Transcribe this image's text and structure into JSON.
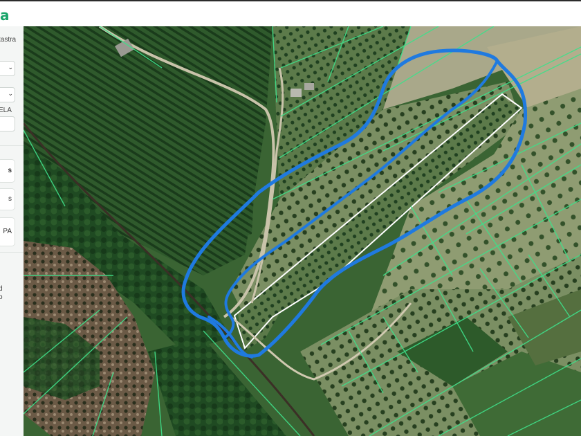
{
  "app": {
    "logo_text": "a"
  },
  "sidebar": {
    "cadastre_label": "tastra",
    "parcel_label": "ELA",
    "cards": [
      {
        "label": "s"
      },
      {
        "label": "s"
      },
      {
        "label": "PA"
      }
    ],
    "footnote_line1": "d",
    "footnote_line2": "o"
  },
  "map": {
    "layer": "satellite",
    "colors": {
      "parcel_lines": "#3fe08a",
      "drawn_outline": "#1f7ae0",
      "selected_parcel": "#ffffff",
      "tree_rows": "#0f3d14"
    },
    "icons": {
      "drawn_area": "freehand-outline-icon",
      "selected": "selected-parcel-outline-icon"
    }
  }
}
